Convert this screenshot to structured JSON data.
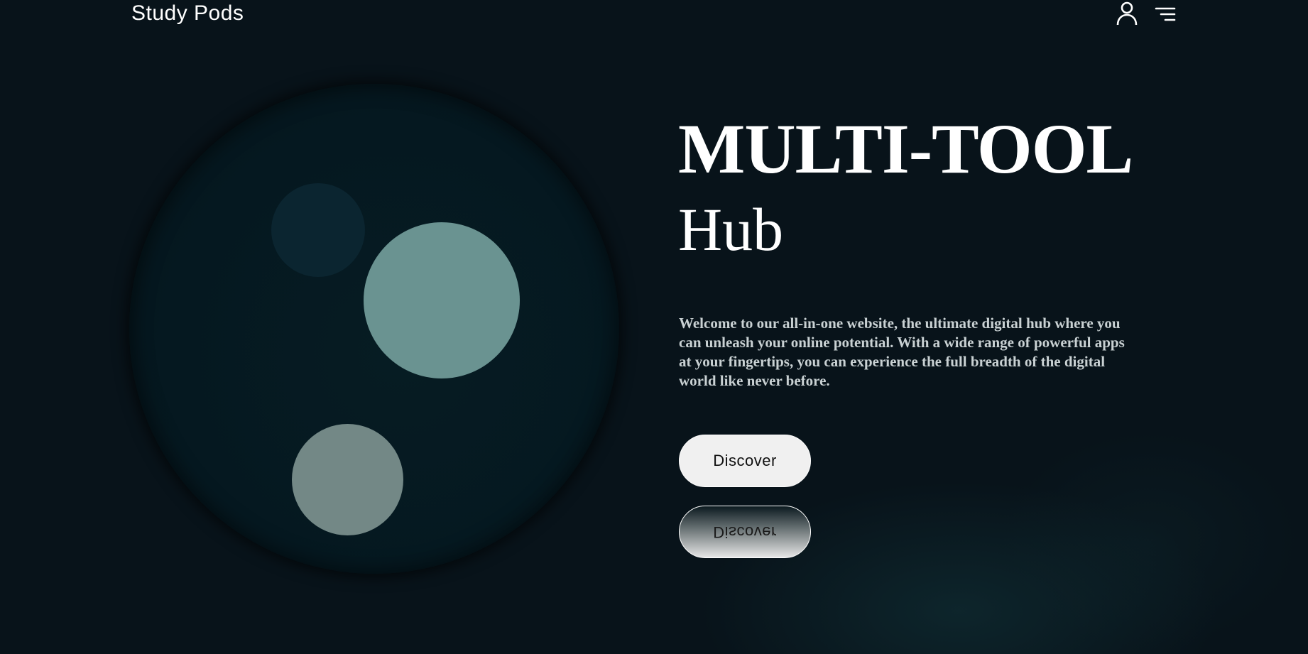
{
  "header": {
    "brand": "Study Pods",
    "icons": [
      "user-icon",
      "menu-icon"
    ]
  },
  "hero": {
    "title": "MULTI-TOOL",
    "subtitle": "Hub",
    "description": "Welcome to our all-in-one website, the ultimate digital hub where you can unleash your online potential. With a wide range of powerful apps at your fingertips, you can experience the full breadth of the digital world like never before.",
    "cta_label": "Discover",
    "cta_reflection_label": "Discover"
  },
  "colors": {
    "background": "#08131a",
    "circle": "#051820",
    "accent_teal": "#6a9391",
    "accent_gray": "#738886",
    "button": "#f0f0f0"
  }
}
